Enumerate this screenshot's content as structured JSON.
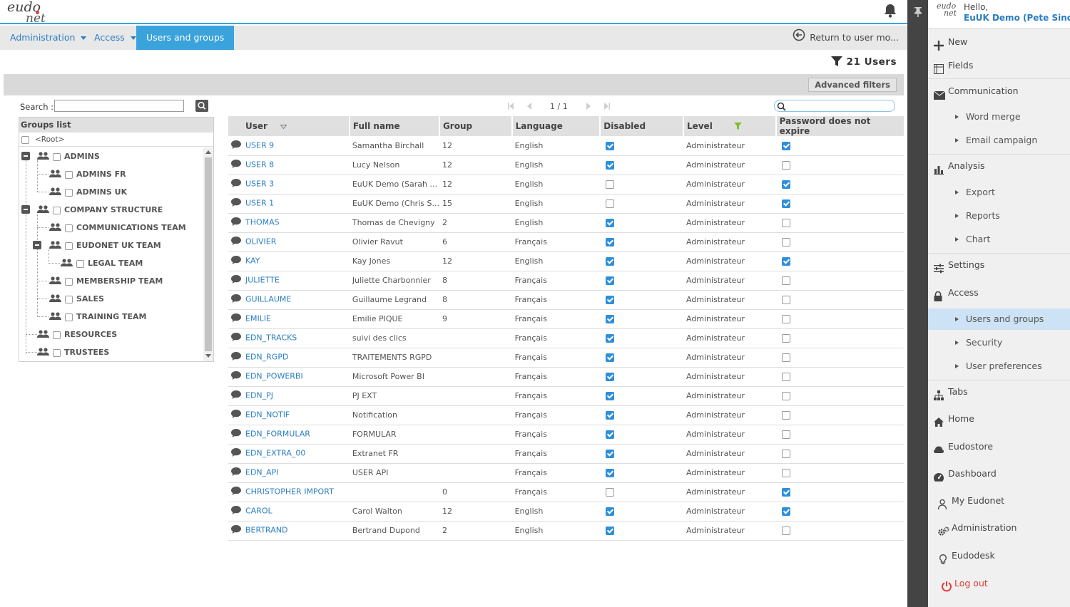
{
  "header": {
    "logo_text_1": "eudo",
    "logo_text_2": "net"
  },
  "breadcrumb": {
    "items": [
      {
        "label": "Administration"
      },
      {
        "label": "Access"
      },
      {
        "label": "Users and groups"
      }
    ],
    "return_label": "Return to user mo..."
  },
  "summary": {
    "count_label": "21 Users"
  },
  "filters": {
    "advanced_label": "Advanced filters"
  },
  "groups_panel": {
    "search_label": "Search :",
    "search_value": "",
    "list_title": "Groups list",
    "root_label": "<Root>",
    "nodes": [
      {
        "label": "ADMINS"
      },
      {
        "label": "ADMINS FR"
      },
      {
        "label": "ADMINS UK"
      },
      {
        "label": "COMPANY STRUCTURE"
      },
      {
        "label": "COMMUNICATIONS TEAM"
      },
      {
        "label": "EUDONET UK TEAM"
      },
      {
        "label": "LEGAL TEAM"
      },
      {
        "label": "MEMBERSHIP TEAM"
      },
      {
        "label": "SALES"
      },
      {
        "label": "TRAINING TEAM"
      },
      {
        "label": "RESOURCES"
      },
      {
        "label": "TRUSTEES"
      }
    ]
  },
  "pager": {
    "label": "1 / 1"
  },
  "table": {
    "columns": [
      "User",
      "Full name",
      "Group",
      "Language",
      "Disabled",
      "Level",
      "Password does not expire"
    ],
    "rows": [
      {
        "user": "USER 9",
        "fullname": "Samantha Birchall",
        "group": "12",
        "language": "English",
        "disabled": true,
        "level": "Administrateur",
        "pwd": true
      },
      {
        "user": "USER 8",
        "fullname": "Lucy Nelson",
        "group": "12",
        "language": "English",
        "disabled": true,
        "level": "Administrateur",
        "pwd": false
      },
      {
        "user": "USER 3",
        "fullname": "EuUK Demo (Sarah ...",
        "group": "12",
        "language": "English",
        "disabled": false,
        "level": "Administrateur",
        "pwd": true
      },
      {
        "user": "USER 1",
        "fullname": "EuUK Demo (Chris S...",
        "group": "15",
        "language": "English",
        "disabled": false,
        "level": "Administrateur",
        "pwd": true
      },
      {
        "user": "THOMAS",
        "fullname": "Thomas de Chevigny",
        "group": "2",
        "language": "English",
        "disabled": true,
        "level": "Administrateur",
        "pwd": false
      },
      {
        "user": "OLIVIER",
        "fullname": "Olivier Ravut",
        "group": "6",
        "language": "Français",
        "disabled": true,
        "level": "Administrateur",
        "pwd": false
      },
      {
        "user": "KAY",
        "fullname": "Kay Jones",
        "group": "12",
        "language": "English",
        "disabled": true,
        "level": "Administrateur",
        "pwd": true
      },
      {
        "user": "JULIETTE",
        "fullname": "Juliette Charbonnier",
        "group": "8",
        "language": "Français",
        "disabled": true,
        "level": "Administrateur",
        "pwd": false
      },
      {
        "user": "GUILLAUME",
        "fullname": "Guillaume Legrand",
        "group": "8",
        "language": "Français",
        "disabled": true,
        "level": "Administrateur",
        "pwd": false
      },
      {
        "user": "EMILIE",
        "fullname": "Emilie PIQUE",
        "group": "9",
        "language": "Français",
        "disabled": true,
        "level": "Administrateur",
        "pwd": false
      },
      {
        "user": "EDN_TRACKS",
        "fullname": "suivi des clics",
        "group": "",
        "language": "Français",
        "disabled": true,
        "level": "Administrateur",
        "pwd": false
      },
      {
        "user": "EDN_RGPD",
        "fullname": "TRAITEMENTS RGPD",
        "group": "",
        "language": "Français",
        "disabled": true,
        "level": "Administrateur",
        "pwd": false
      },
      {
        "user": "EDN_POWERBI",
        "fullname": "Microsoft Power BI",
        "group": "",
        "language": "Français",
        "disabled": true,
        "level": "Administrateur",
        "pwd": false
      },
      {
        "user": "EDN_PJ",
        "fullname": "PJ EXT",
        "group": "",
        "language": "Français",
        "disabled": true,
        "level": "Administrateur",
        "pwd": false
      },
      {
        "user": "EDN_NOTIF",
        "fullname": "Notification",
        "group": "",
        "language": "Français",
        "disabled": true,
        "level": "Administrateur",
        "pwd": false
      },
      {
        "user": "EDN_FORMULAR",
        "fullname": "FORMULAR",
        "group": "",
        "language": "Français",
        "disabled": true,
        "level": "Administrateur",
        "pwd": false
      },
      {
        "user": "EDN_EXTRA_00",
        "fullname": "Extranet FR",
        "group": "",
        "language": "Français",
        "disabled": true,
        "level": "Administrateur",
        "pwd": false
      },
      {
        "user": "EDN_API",
        "fullname": "USER API",
        "group": "",
        "language": "Français",
        "disabled": true,
        "level": "Administrateur",
        "pwd": false
      },
      {
        "user": "CHRISTOPHER IMPORT",
        "fullname": "",
        "group": "0",
        "language": "Français",
        "disabled": false,
        "level": "Administrateur",
        "pwd": true
      },
      {
        "user": "CAROL",
        "fullname": "Carol Walton",
        "group": "12",
        "language": "English",
        "disabled": true,
        "level": "Administrateur",
        "pwd": true
      },
      {
        "user": "BERTRAND",
        "fullname": "Bertrand Dupond",
        "group": "2",
        "language": "English",
        "disabled": true,
        "level": "Administrateur",
        "pwd": false
      }
    ]
  },
  "sidebar": {
    "hello": "Hello,",
    "user_name": "EuUK Demo (Pete Sinclair)",
    "mini_logo_1": "eudo",
    "mini_logo_2": "net",
    "items": [
      {
        "label": "New",
        "icon": "plus-icon"
      },
      {
        "label": "Fields",
        "icon": "fields-icon"
      },
      {
        "label": "Communication",
        "icon": "envelope-icon"
      },
      {
        "label": "Word merge",
        "sub": true
      },
      {
        "label": "Email campaign",
        "sub": true
      },
      {
        "label": "Analysis",
        "icon": "bar-chart-icon"
      },
      {
        "label": "Export",
        "sub": true
      },
      {
        "label": "Reports",
        "sub": true
      },
      {
        "label": "Chart",
        "sub": true
      },
      {
        "label": "Settings",
        "icon": "sliders-icon"
      },
      {
        "label": "Access",
        "icon": "lock-icon"
      },
      {
        "label": "Users and groups",
        "sub": true,
        "active": true
      },
      {
        "label": "Security",
        "sub": true
      },
      {
        "label": "User preferences",
        "sub": true
      },
      {
        "label": "Tabs",
        "icon": "sitemap-icon"
      },
      {
        "label": "Home",
        "icon": "home-icon"
      },
      {
        "label": "Eudostore",
        "icon": "store-icon"
      },
      {
        "label": "Dashboard",
        "icon": "dashboard-icon"
      },
      {
        "label": "My Eudonet",
        "icon": "user-icon"
      },
      {
        "label": "Administration",
        "icon": "gears-icon"
      },
      {
        "label": "Eudodesk",
        "icon": "bulb-icon"
      },
      {
        "label": "Log out",
        "icon": "power-icon"
      }
    ]
  },
  "colors": {
    "accent": "#3aa3dc",
    "link": "#2b7ec2",
    "logout": "#e53935",
    "check": "#2f8fd8"
  }
}
